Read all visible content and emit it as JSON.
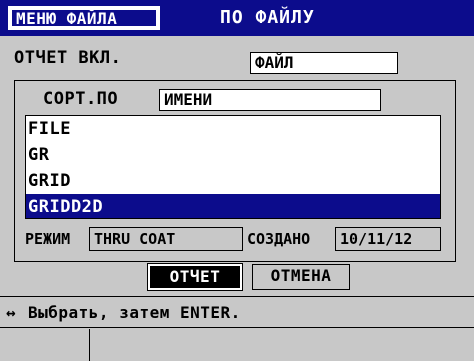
{
  "title_bar": {
    "menu_tab": "МЕНЮ ФАЙЛА",
    "title": "ПО ФАЙЛУ"
  },
  "report": {
    "label": "ОТЧЕТ ВКЛ.",
    "value": "ФАЙЛ"
  },
  "sort": {
    "label": "СОРТ.ПО",
    "value": "ИМЕНИ"
  },
  "files": [
    {
      "name": "FILE",
      "selected": false
    },
    {
      "name": "GR",
      "selected": false
    },
    {
      "name": "GRID",
      "selected": false
    },
    {
      "name": "GRIDD2D",
      "selected": true
    }
  ],
  "details": {
    "mode_label": "РЕЖИМ",
    "mode_value": "THRU COAT",
    "created_label": "СОЗДАНО",
    "created_value": "10/11/12"
  },
  "buttons": {
    "report": "ОТЧЕТ",
    "cancel": "ОТМЕНА"
  },
  "help": {
    "arrow_icon": "left-right-arrow-icon",
    "arrow_glyph": "↔",
    "text": "Выбрать, затем ENTER."
  },
  "colors": {
    "accent": "#0c0c8c",
    "background": "#c8c8c8"
  }
}
